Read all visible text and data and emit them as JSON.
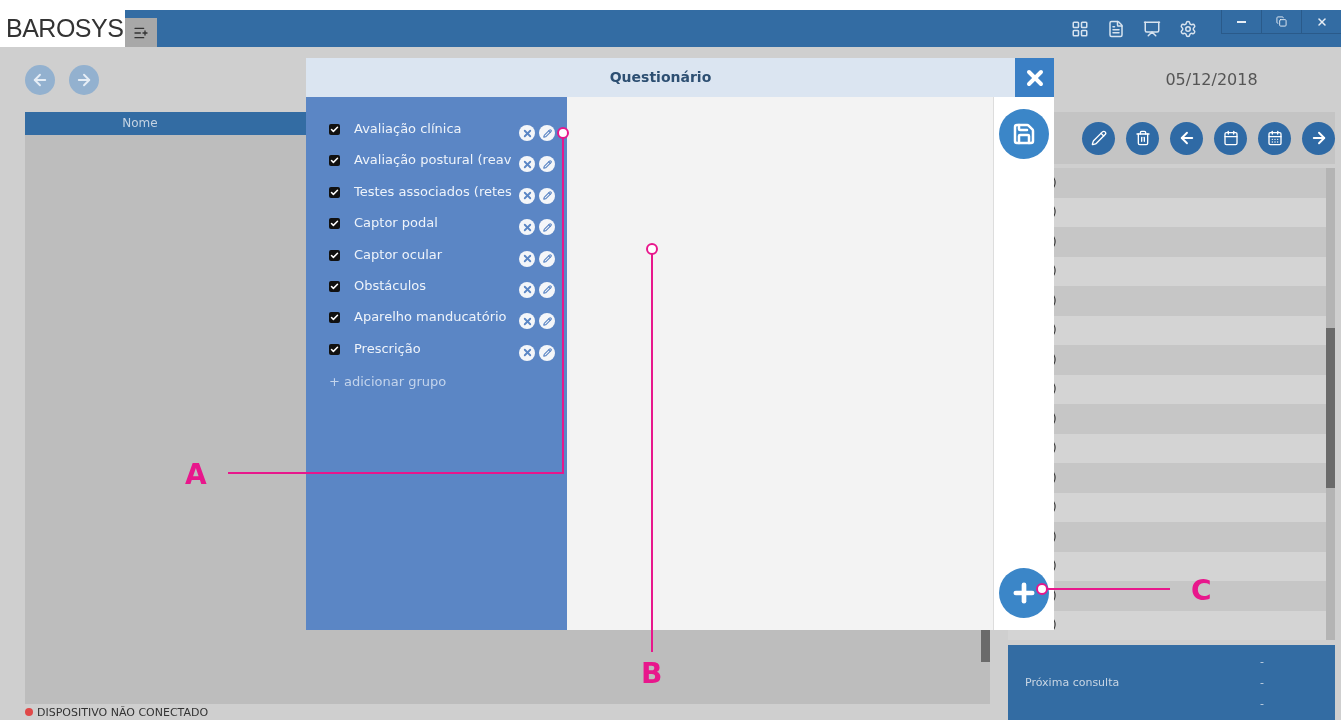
{
  "app": {
    "logo": "BAROSYS"
  },
  "left_panel": {
    "table": {
      "columns": [
        "Nome"
      ]
    },
    "status": "DISPOSITIVO NÃO CONECTADO"
  },
  "right_panel": {
    "date": "05/12/2018",
    "rows": [
      ")",
      ")",
      ")",
      ")",
      ")",
      ")",
      ")",
      ")",
      ")",
      ")",
      ")",
      ")",
      ")",
      ")",
      ")",
      ")"
    ],
    "summary": {
      "label": "Próxima consulta",
      "values": [
        "-",
        "-",
        "-"
      ]
    }
  },
  "dialog": {
    "title": "Questionário",
    "groups": [
      {
        "label": "Avaliação clínica",
        "checked": true
      },
      {
        "label": "Avaliação postural (reav",
        "checked": true
      },
      {
        "label": "Testes associados (retes",
        "checked": true
      },
      {
        "label": "Captor podal",
        "checked": true
      },
      {
        "label": "Captor ocular",
        "checked": true
      },
      {
        "label": "Obstáculos",
        "checked": true
      },
      {
        "label": "Aparelho manducatório",
        "checked": true
      },
      {
        "label": "Prescrição",
        "checked": true
      }
    ],
    "add_group": "+ adicionar grupo"
  },
  "annotations": [
    {
      "label": "A"
    },
    {
      "label": "B"
    },
    {
      "label": "C"
    }
  ]
}
